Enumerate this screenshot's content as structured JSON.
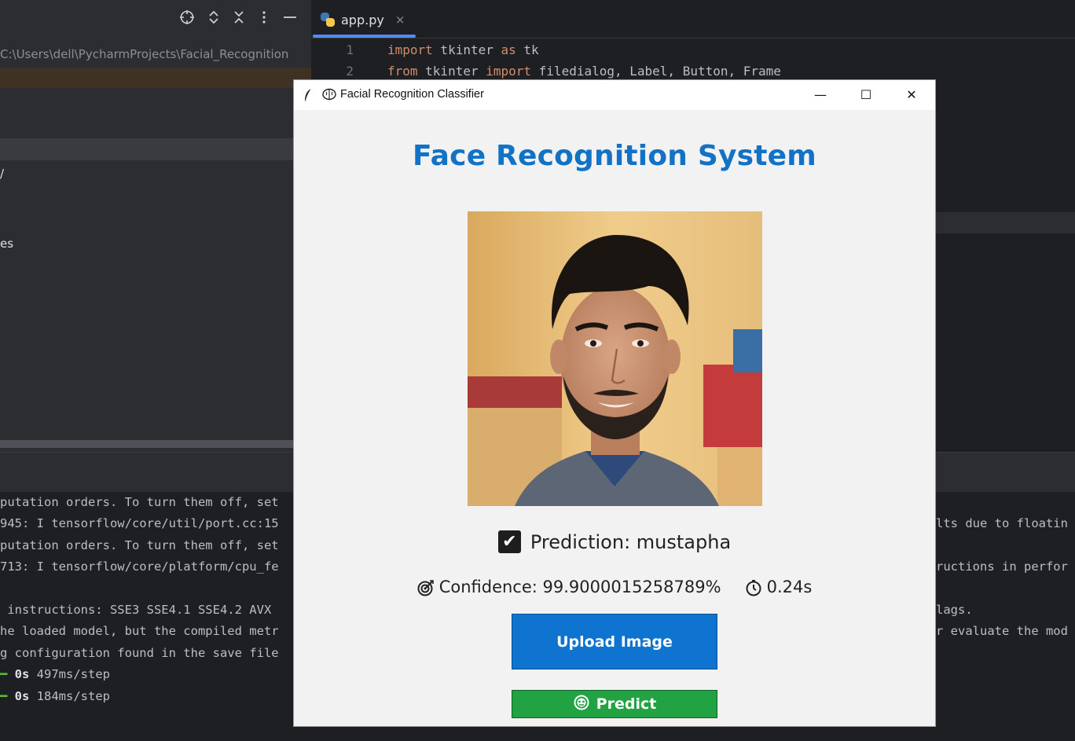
{
  "ide": {
    "path": "C:\\Users\\dell\\PycharmProjects\\Facial_Recognition",
    "tree_fragments": [
      "/",
      "es"
    ],
    "tab": {
      "label": "app.py",
      "close": "×"
    },
    "toolbar_icons": [
      "crosshair-icon",
      "expand-collapse-icon",
      "collapse-all-icon",
      "more-vertical-icon",
      "minimize-icon"
    ],
    "code": [
      {
        "no": "1",
        "parts": [
          [
            "kw",
            "import"
          ],
          [
            "t",
            " tkinter "
          ],
          [
            "kw",
            "as"
          ],
          [
            "t",
            " tk"
          ]
        ]
      },
      {
        "no": "2",
        "parts": [
          [
            "kw",
            "from"
          ],
          [
            "t",
            " tkinter "
          ],
          [
            "kw",
            "import"
          ],
          [
            "t",
            " filedialog, Label, Button, Frame"
          ]
        ]
      }
    ],
    "console_left": [
      "putation orders. To turn them off, set",
      "945: I tensorflow/core/util/port.cc:15",
      "putation orders. To turn them off, set",
      "713: I tensorflow/core/platform/cpu_fe",
      "",
      " instructions: SSE3 SSE4.1 SSE4.2 AVX ",
      "he loaded model, but the compiled metr",
      "g configuration found in the save file"
    ],
    "console_right": [
      {
        "row": 1,
        "text": "lts due to floatin"
      },
      {
        "row": 3,
        "text": "ructions in perfor"
      },
      {
        "row": 5,
        "text": "lags."
      },
      {
        "row": 6,
        "text": "r evaluate the mod"
      }
    ],
    "console_steps": [
      {
        "dash": "━",
        "bold": "0s",
        "rest": " 497ms/step"
      },
      {
        "dash": "━",
        "bold": "0s",
        "rest": " 184ms/step"
      }
    ]
  },
  "window": {
    "title": "Facial Recognition Classifier",
    "minimize": "—",
    "maximize": "☐",
    "close": "✕"
  },
  "app": {
    "heading": "Face Recognition System",
    "check": "✔",
    "prediction": "Prediction: mustapha",
    "confidence": "Confidence: 99.9000015258789%",
    "time": "0.24s",
    "upload_label": "Upload Image",
    "predict_label": "Predict"
  }
}
